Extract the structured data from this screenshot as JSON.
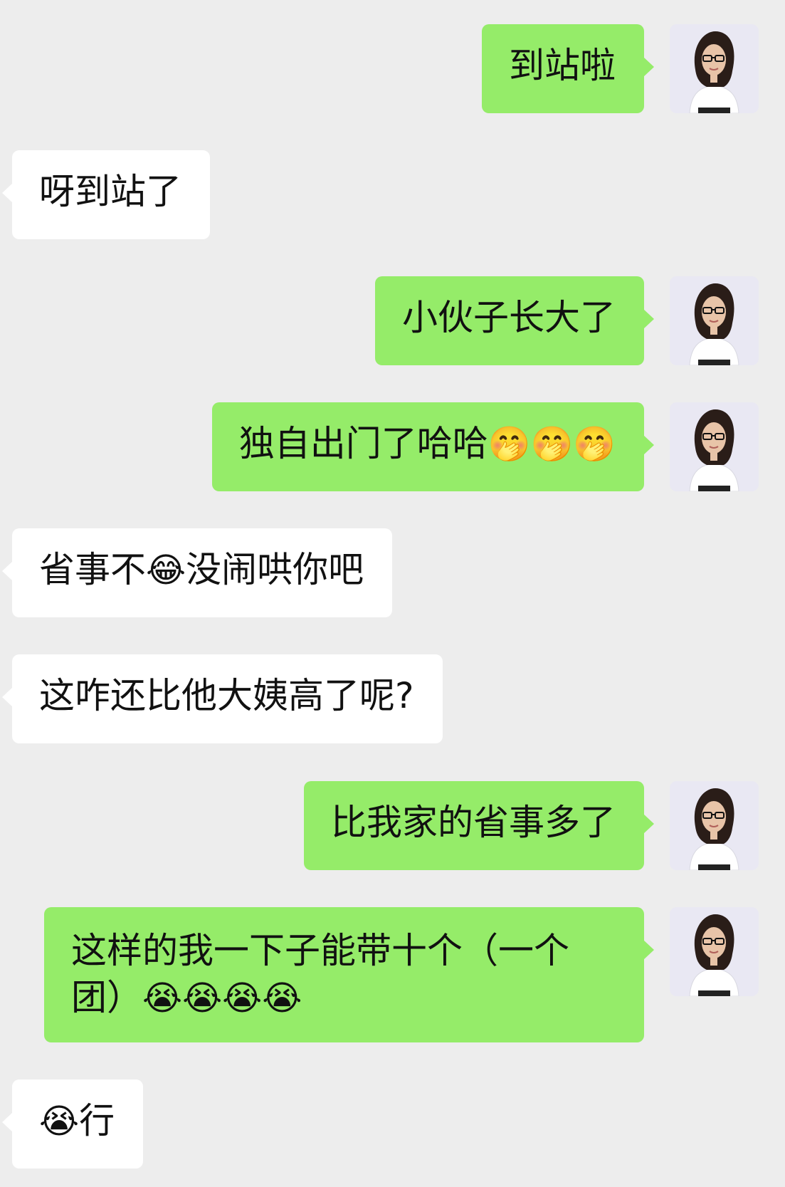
{
  "messages": [
    {
      "side": "out",
      "text": "到站啦"
    },
    {
      "side": "in",
      "text": "呀到站了"
    },
    {
      "side": "out",
      "text": "小伙子长大了"
    },
    {
      "side": "out",
      "text": "独自出门了哈哈",
      "emoji": "🤭🤭🤭"
    },
    {
      "side": "in",
      "text_before": "省事不",
      "emoji": "😂",
      "text_after": "没闹哄你吧"
    },
    {
      "side": "in",
      "text": "这咋还比他大姨高了呢?"
    },
    {
      "side": "out",
      "text": "比我家的省事多了"
    },
    {
      "side": "out",
      "line1": "这样的我一下子能带十个（一个",
      "line2": "团）",
      "emoji": "😭😭😭😭"
    },
    {
      "side": "in",
      "emoji": "😭",
      "text": "行"
    }
  ],
  "colors": {
    "background": "#ededed",
    "outgoing_bubble": "#95ec69",
    "incoming_bubble": "#ffffff"
  },
  "avatar_icon": "user-avatar-woman-glasses"
}
